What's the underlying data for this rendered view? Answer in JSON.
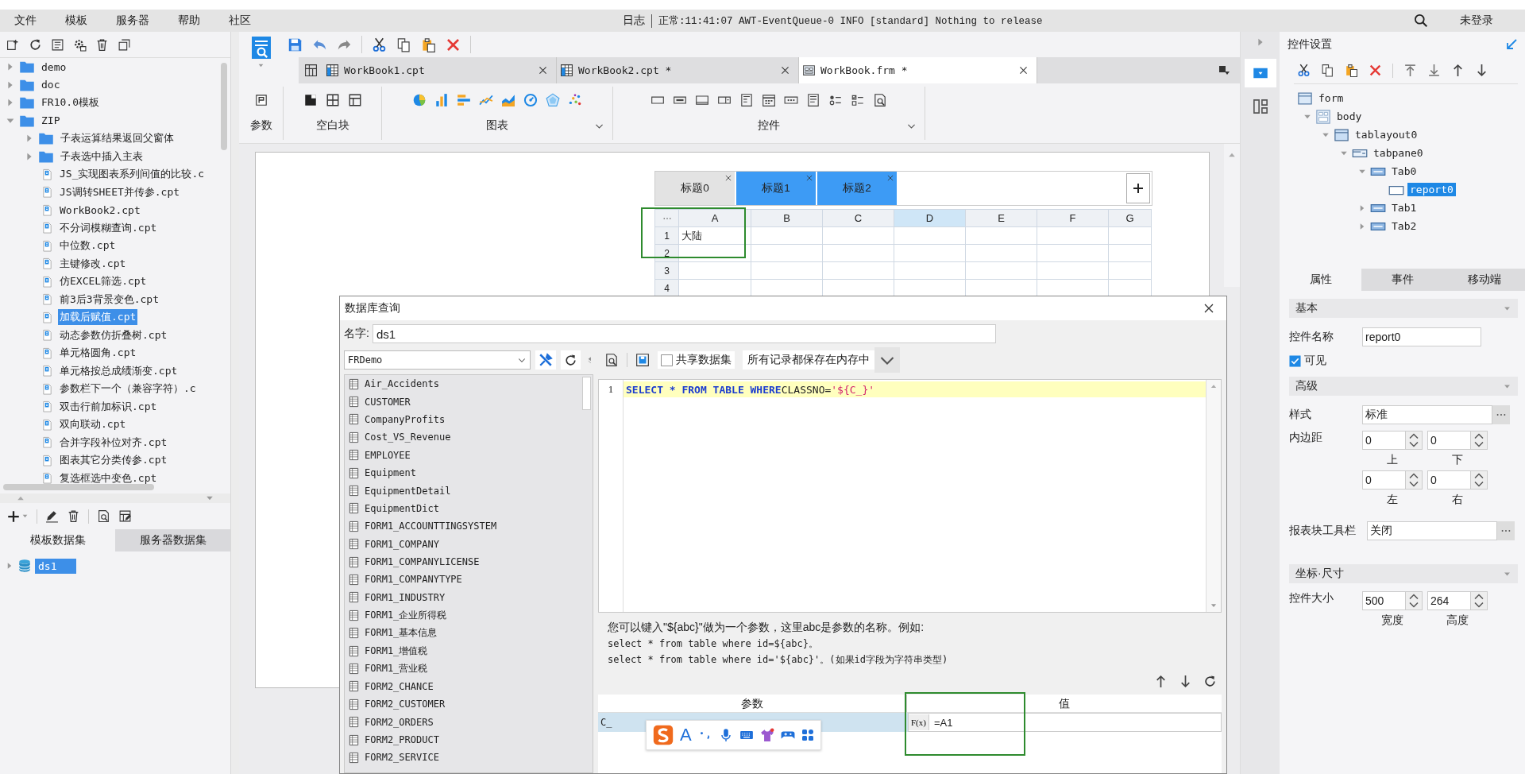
{
  "menu": [
    {
      "label": "文件"
    },
    {
      "label": "模板"
    },
    {
      "label": "服务器"
    },
    {
      "label": "帮助"
    },
    {
      "label": "社区"
    }
  ],
  "log": {
    "label": "日志",
    "message": "正常:11:41:07 AWT-EventQueue-0 INFO [standard] Nothing to release"
  },
  "account": "未登录",
  "file_tree": [
    {
      "name": "demo",
      "kind": "folder",
      "expanded": false,
      "selected": false
    },
    {
      "name": "doc",
      "kind": "folder",
      "expanded": false,
      "selected": false
    },
    {
      "name": "FR10.0模板",
      "kind": "folder",
      "expanded": false,
      "selected": false
    },
    {
      "name": "ZIP",
      "kind": "folder",
      "expanded": true,
      "selected": false,
      "children": [
        {
          "name": "子表运算结果返回父窗体",
          "kind": "folder",
          "expanded": false,
          "selected": false
        },
        {
          "name": "子表选中插入主表",
          "kind": "folder",
          "expanded": false,
          "selected": false
        },
        {
          "name": "JS_实现图表系列间值的比较.c",
          "kind": "file",
          "selected": false
        },
        {
          "name": "JS调转SHEET并传参.cpt",
          "kind": "file",
          "selected": false
        },
        {
          "name": "WorkBook2.cpt",
          "kind": "file",
          "selected": false
        },
        {
          "name": "不分词模糊查询.cpt",
          "kind": "file",
          "selected": false
        },
        {
          "name": "中位数.cpt",
          "kind": "file",
          "selected": false
        },
        {
          "name": "主键修改.cpt",
          "kind": "file",
          "selected": false
        },
        {
          "name": "仿EXCEL筛选.cpt",
          "kind": "file",
          "selected": false
        },
        {
          "name": "前3后3背景变色.cpt",
          "kind": "file",
          "selected": false
        },
        {
          "name": "加载后赋值.cpt",
          "kind": "file",
          "selected": true
        },
        {
          "name": "动态参数仿折叠树.cpt",
          "kind": "file",
          "selected": false
        },
        {
          "name": "单元格圆角.cpt",
          "kind": "file",
          "selected": false
        },
        {
          "name": "单元格按总成绩渐变.cpt",
          "kind": "file",
          "selected": false
        },
        {
          "name": "参数栏下一个（兼容字符）.c",
          "kind": "file",
          "selected": false
        },
        {
          "name": "双击行前加标识.cpt",
          "kind": "file",
          "selected": false
        },
        {
          "name": "双向联动.cpt",
          "kind": "file",
          "selected": false
        },
        {
          "name": "合并字段补位对齐.cpt",
          "kind": "file",
          "selected": false
        },
        {
          "name": "图表其它分类传参.cpt",
          "kind": "file",
          "selected": false
        },
        {
          "name": "复选框选中变色.cpt",
          "kind": "file",
          "selected": false
        }
      ]
    }
  ],
  "dataset_tabs": [
    {
      "label": "模板数据集",
      "selected": true
    },
    {
      "label": "服务器数据集",
      "selected": false
    }
  ],
  "datasets": [
    {
      "name": "ds1",
      "selected": true
    }
  ],
  "doc_tabs": [
    {
      "label": "WorkBook1.cpt",
      "kind": "cpt",
      "selected": false
    },
    {
      "label": "WorkBook2.cpt *",
      "kind": "cpt",
      "selected": false
    },
    {
      "label": "WorkBook.frm *",
      "kind": "frm",
      "selected": true
    }
  ],
  "toolbar_groups": [
    {
      "label": "参数",
      "has_menu": false
    },
    {
      "label": "空白块",
      "has_menu": false
    },
    {
      "label": "图表",
      "has_menu": true
    },
    {
      "label": "控件",
      "has_menu": true
    }
  ],
  "form_widget": {
    "tabs": [
      {
        "label": "标题0",
        "selected": true
      },
      {
        "label": "标题1",
        "selected": false
      },
      {
        "label": "标题2",
        "selected": false
      }
    ],
    "columns": [
      {
        "label": "A",
        "selected": false
      },
      {
        "label": "B",
        "selected": false
      },
      {
        "label": "C",
        "selected": false
      },
      {
        "label": "D",
        "selected": true
      },
      {
        "label": "E",
        "selected": false
      },
      {
        "label": "F",
        "selected": false
      },
      {
        "label": "G",
        "selected": false
      }
    ],
    "rows": [
      {
        "number": "1",
        "cells": [
          "大陆"
        ]
      },
      {
        "number": "2"
      },
      {
        "number": "3"
      },
      {
        "number": "4"
      }
    ]
  },
  "query_dialog": {
    "title": "数据库查询",
    "name_label": "名字:",
    "name_value": "ds1",
    "connection": "FRDemo",
    "tables": [
      "Air_Accidents",
      "CUSTOMER",
      "CompanyProfits",
      "Cost_VS_Revenue",
      "EMPLOYEE",
      "Equipment",
      "EquipmentDetail",
      "EquipmentDict",
      "FORM1_ACCOUNTTINGSYSTEM",
      "FORM1_COMPANY",
      "FORM1_COMPANYLICENSE",
      "FORM1_COMPANYTYPE",
      "FORM1_INDUSTRY",
      "FORM1_企业所得税",
      "FORM1_基本信息",
      "FORM1_增值税",
      "FORM1_营业税",
      "FORM2_CHANCE",
      "FORM2_CUSTOMER",
      "FORM2_ORDERS",
      "FORM2_PRODUCT",
      "FORM2_SERVICE"
    ],
    "share_dataset": {
      "label": "共享数据集",
      "checked": false
    },
    "cache_mode": "所有记录都保存在内存中",
    "sql_lines": [
      {
        "number": "1",
        "tokens": [
          {
            "text": "SELECT * FROM TABLE WHERE",
            "kind": "keyword"
          },
          {
            "text": "CLASSNO=",
            "kind": "plain"
          },
          {
            "text": "'${C_}'",
            "kind": "string"
          }
        ]
      }
    ],
    "help": [
      "您可以键入\"${abc}\"做为一个参数，这里abc是参数的名称。例如:",
      "select * from table where id=${abc}。",
      "select * from table where id='${abc}'。(如果id字段为字符串类型)"
    ],
    "param_columns": [
      "参数",
      "值"
    ],
    "params": [
      {
        "name": "C_",
        "value": "=A1",
        "selected": true
      }
    ],
    "formula_button": "F(x)",
    "ime_letter": "A"
  },
  "widget_settings": {
    "title": "控件设置",
    "tree": [
      {
        "name": "form",
        "kind": "form",
        "selected": false,
        "children": [
          {
            "name": "body",
            "kind": "body",
            "expanded": true,
            "selected": false,
            "children": [
              {
                "name": "tablayout0",
                "kind": "layout",
                "expanded": true,
                "selected": false,
                "children": [
                  {
                    "name": "tabpane0",
                    "kind": "tabpane",
                    "expanded": true,
                    "selected": false,
                    "children": [
                      {
                        "name": "Tab0",
                        "kind": "tab",
                        "expanded": true,
                        "selected": false,
                        "children": [
                          {
                            "name": "report0",
                            "kind": "report",
                            "selected": true
                          }
                        ]
                      },
                      {
                        "name": "Tab1",
                        "kind": "tab",
                        "expanded": false,
                        "selected": false
                      },
                      {
                        "name": "Tab2",
                        "kind": "tab",
                        "expanded": false,
                        "selected": false
                      }
                    ]
                  }
                ]
              }
            ]
          }
        ]
      }
    ],
    "tabs": [
      {
        "label": "属性",
        "selected": true
      },
      {
        "label": "事件",
        "selected": false
      },
      {
        "label": "移动端",
        "selected": false
      }
    ],
    "basic": {
      "title": "基本",
      "name_label": "控件名称",
      "name_value": "report0",
      "visible": {
        "label": "可见",
        "checked": true
      }
    },
    "advanced": {
      "title": "高级",
      "style_label": "样式",
      "style_value": "标准",
      "padding_label": "内边距",
      "padding": [
        {
          "value": "0",
          "label": "上"
        },
        {
          "value": "0",
          "label": "下"
        },
        {
          "value": "0",
          "label": "左"
        },
        {
          "value": "0",
          "label": "右"
        }
      ],
      "toolbar_label": "报表块工具栏",
      "toolbar_value": "关闭"
    },
    "geometry": {
      "title": "坐标·尺寸",
      "size_label": "控件大小",
      "size": [
        {
          "value": "500",
          "label": "宽度"
        },
        {
          "value": "264",
          "label": "高度"
        }
      ]
    }
  }
}
